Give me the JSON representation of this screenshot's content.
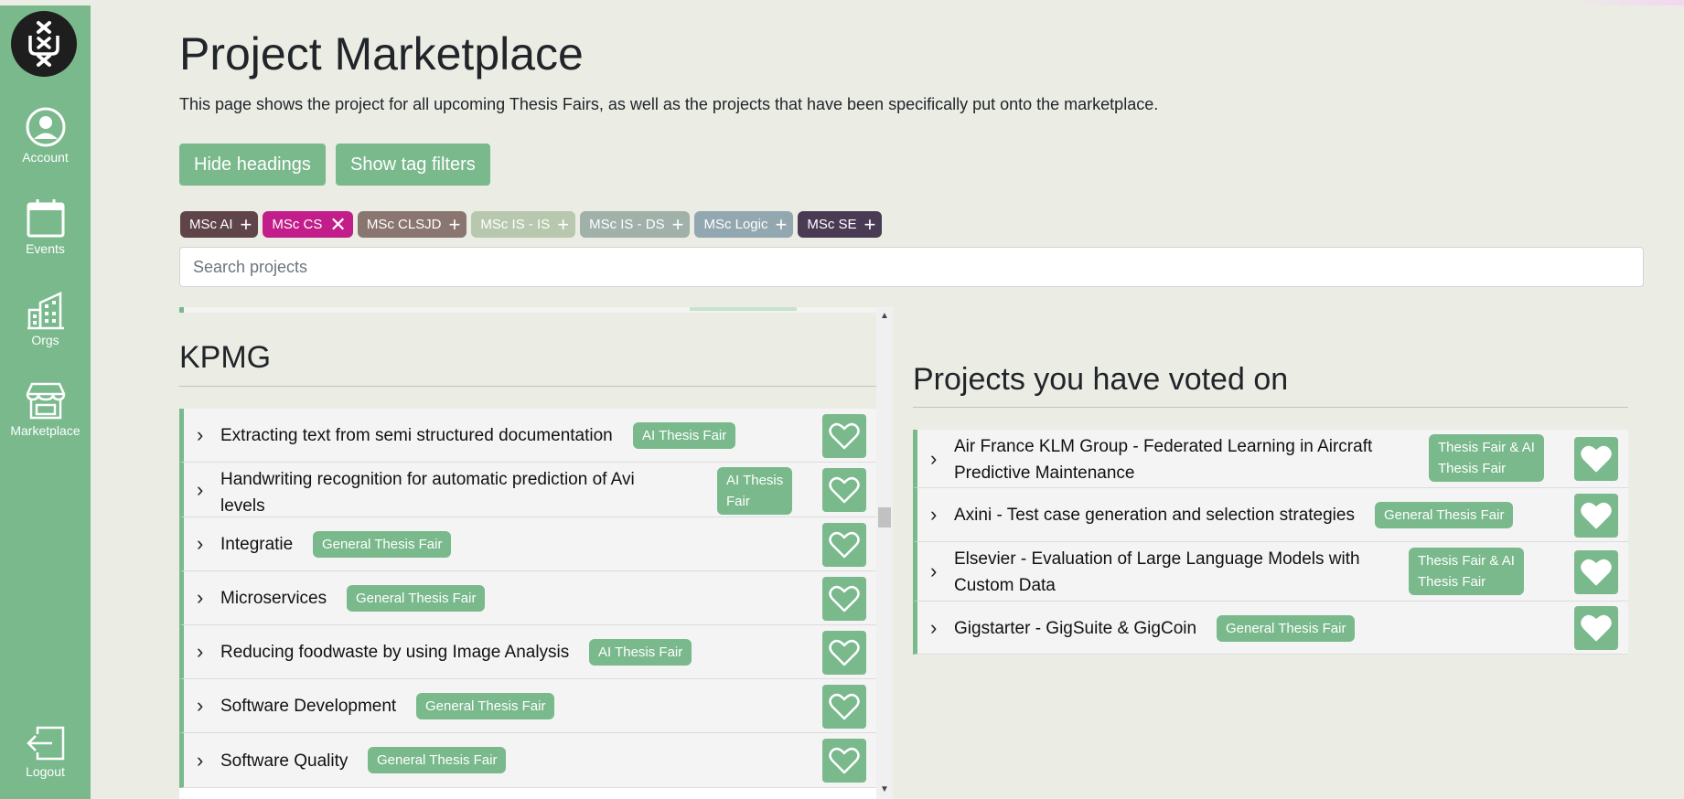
{
  "sidebar": {
    "logo_icon": "university-crest-icon",
    "items": [
      {
        "label": "Account",
        "icon": "account-icon"
      },
      {
        "label": "Events",
        "icon": "calendar-icon"
      },
      {
        "label": "Orgs",
        "icon": "buildings-icon"
      },
      {
        "label": "Marketplace",
        "icon": "store-icon"
      }
    ],
    "logout": {
      "label": "Logout",
      "icon": "logout-icon"
    }
  },
  "header": {
    "title": "Project Marketplace",
    "description": "This page shows the project for all upcoming Thesis Fairs, as well as the projects that have been specifically put onto the marketplace."
  },
  "buttons": {
    "hide_headings": "Hide headings",
    "show_tag_filters": "Show tag filters"
  },
  "tags": [
    {
      "label": "MSc AI",
      "symbol": "+",
      "color": "#5f4449",
      "state": "add"
    },
    {
      "label": "MSc CS",
      "symbol": "✕",
      "color": "#c21d8a",
      "state": "selected"
    },
    {
      "label": "MSc CLSJD",
      "symbol": "+",
      "color": "#8a7670",
      "state": "add"
    },
    {
      "label": "MSc IS - IS",
      "symbol": "+",
      "color": "#b7c8ae",
      "state": "add"
    },
    {
      "label": "MSc IS - DS",
      "symbol": "+",
      "color": "#9fb1a9",
      "state": "add"
    },
    {
      "label": "MSc Logic",
      "symbol": "+",
      "color": "#92a7b0",
      "state": "add"
    },
    {
      "label": "MSc SE",
      "symbol": "+",
      "color": "#4a3b55",
      "state": "add"
    }
  ],
  "search": {
    "placeholder": "Search projects",
    "value": ""
  },
  "company_section": {
    "name": "KPMG",
    "projects": [
      {
        "title": "Extracting text from semi structured documentation",
        "badge": "AI Thesis Fair"
      },
      {
        "title": "Handwriting recognition for automatic prediction of Avi levels",
        "title_lines": [
          "Handwriting recognition for automatic prediction of Avi",
          "levels"
        ],
        "badge_lines": [
          "AI Thesis",
          "Fair"
        ]
      },
      {
        "title": "Integratie",
        "badge": "General Thesis Fair"
      },
      {
        "title": "Microservices",
        "badge": "General Thesis Fair"
      },
      {
        "title": "Reducing foodwaste by using Image Analysis",
        "badge": "AI Thesis Fair"
      },
      {
        "title": "Software Development",
        "badge": "General Thesis Fair"
      },
      {
        "title": "Software Quality",
        "badge": "General Thesis Fair"
      }
    ]
  },
  "voted_section": {
    "heading": "Projects you have voted on",
    "projects": [
      {
        "title_lines": [
          "Air France KLM Group - Federated Learning in Aircraft",
          "Predictive Maintenance"
        ],
        "badge_lines": [
          "Thesis Fair & AI",
          "Thesis Fair"
        ]
      },
      {
        "title": "Axini - Test case generation and selection strategies",
        "badge": "General Thesis Fair"
      },
      {
        "title_lines": [
          "Elsevier - Evaluation of Large Language Models with",
          "Custom Data"
        ],
        "badge_lines": [
          "Thesis Fair & AI",
          "Thesis Fair"
        ]
      },
      {
        "title": "Gigstarter - GigSuite & GigCoin",
        "badge": "General Thesis Fair"
      }
    ]
  },
  "colors": {
    "accent": "#79b98c",
    "background": "#ebede5",
    "row_bg": "#f4f4f4"
  }
}
